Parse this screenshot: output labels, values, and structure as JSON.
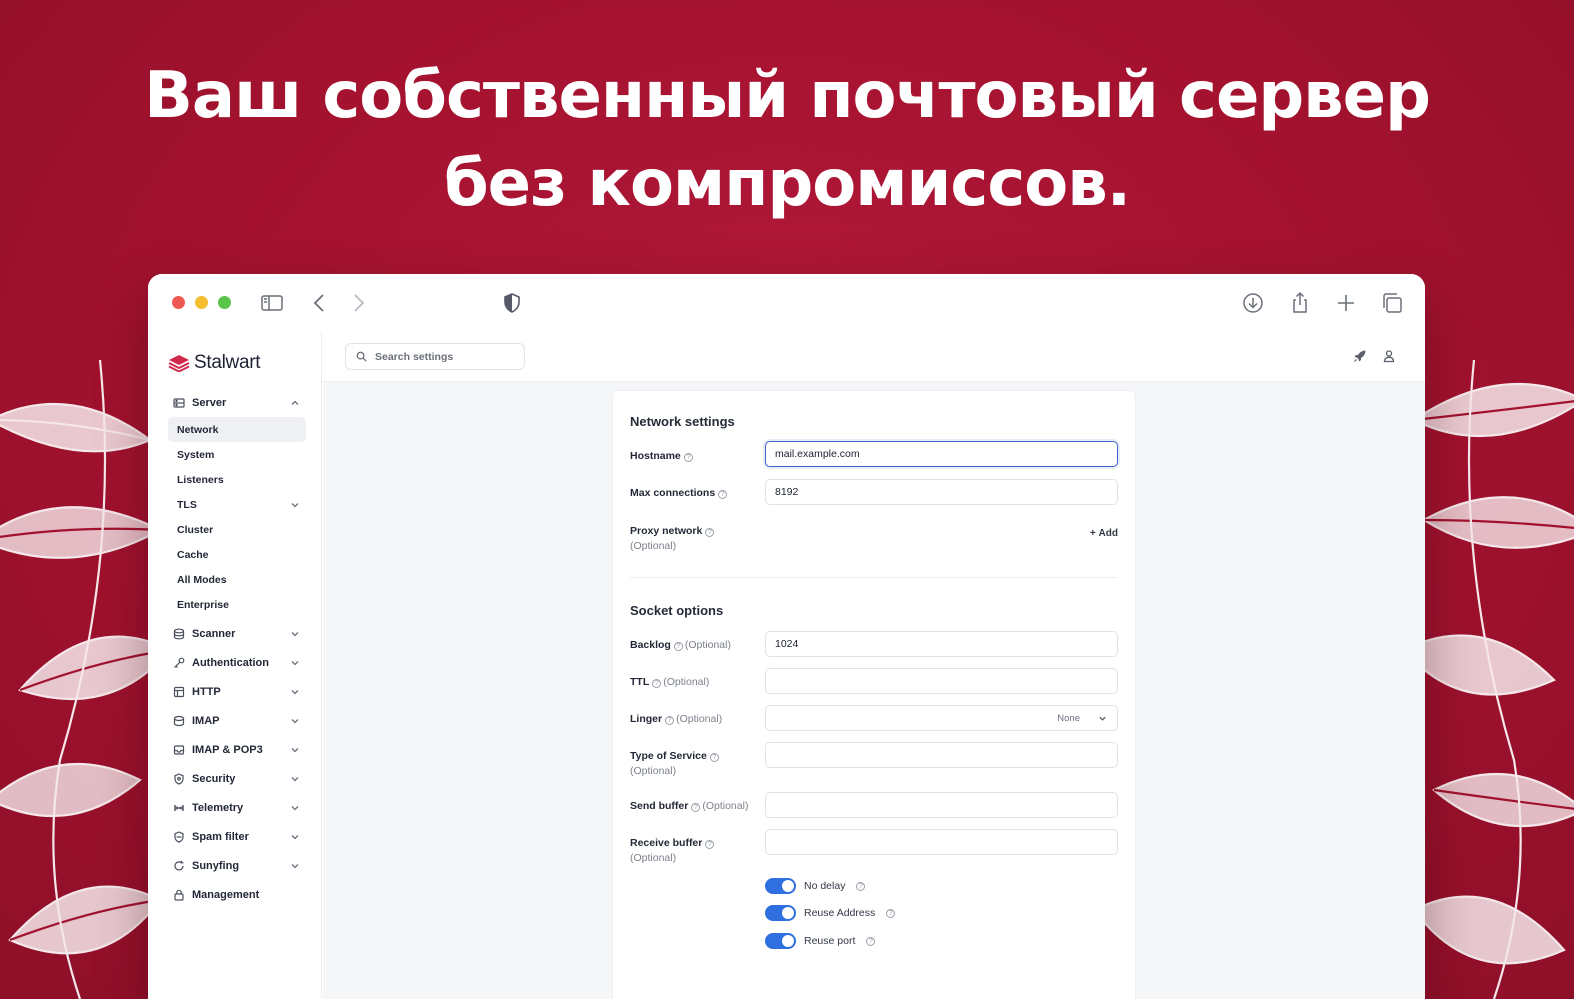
{
  "hero": {
    "line1": "Ваш собственный почтовый сервер",
    "line2": "без компромиссов."
  },
  "colors": {
    "background": "#a3122f",
    "accent": "#2f6fe0",
    "brand": "#d0294b"
  },
  "brand": {
    "name": "Stalwart",
    "icon": "stalwart-logo-icon"
  },
  "search": {
    "placeholder": "Search settings",
    "icon": "search-icon"
  },
  "topbar_icons": [
    "rocket-icon",
    "user-icon"
  ],
  "browser_icons": [
    "sidebar-toggle-icon",
    "back-icon",
    "forward-icon",
    "shield-icon",
    "download-icon",
    "share-icon",
    "plus-icon",
    "tabs-icon"
  ],
  "sidebar": {
    "server": {
      "label": "Server",
      "items": [
        "Network",
        "System",
        "Listeners",
        "TLS",
        "Cluster",
        "Cache",
        "All Modes",
        "Enterprise"
      ]
    },
    "groups": [
      {
        "label": "Scanner",
        "icon": "scanner-icon"
      },
      {
        "label": "Authentication",
        "icon": "key-icon"
      },
      {
        "label": "HTTP",
        "icon": "http-icon"
      },
      {
        "label": "IMAP",
        "icon": "imap-icon"
      },
      {
        "label": "IMAP & POP3",
        "icon": "inbox-icon"
      },
      {
        "label": "Security",
        "icon": "security-icon"
      },
      {
        "label": "Telemetry",
        "icon": "telemetry-icon"
      },
      {
        "label": "Spam filter",
        "icon": "spam-filter-icon"
      },
      {
        "label": "Sunyfing",
        "icon": "sync-icon"
      },
      {
        "label": "Management",
        "icon": "management-icon"
      }
    ]
  },
  "network": {
    "title": "Network settings",
    "hostname": {
      "label": "Hostname",
      "value": "mail.example.com"
    },
    "max_connections": {
      "label": "Max connections",
      "value": "8192"
    },
    "proxy_network": {
      "label": "Proxy network",
      "optional": "(Optional)",
      "add_label": "Add"
    }
  },
  "socket": {
    "title": "Socket options",
    "backlog": {
      "label": "Backlog",
      "optional": "(Optional)",
      "value": "1024"
    },
    "ttl": {
      "label": "TTL",
      "optional": "(Optional)",
      "value": ""
    },
    "linger": {
      "label": "Linger",
      "optional": "(Optional)",
      "value": "None"
    },
    "tos": {
      "label": "Type of Service",
      "optional": "(Optional)",
      "value": ""
    },
    "send_buffer": {
      "label": "Send buffer",
      "optional": "(Optional)",
      "value": ""
    },
    "receive_buffer": {
      "label": "Receive buffer",
      "optional": "(Optional)",
      "value": ""
    },
    "toggles": [
      {
        "label": "No delay",
        "on": true
      },
      {
        "label": "Reuse Address",
        "on": true
      },
      {
        "label": "Reuse port",
        "on": true
      }
    ]
  }
}
